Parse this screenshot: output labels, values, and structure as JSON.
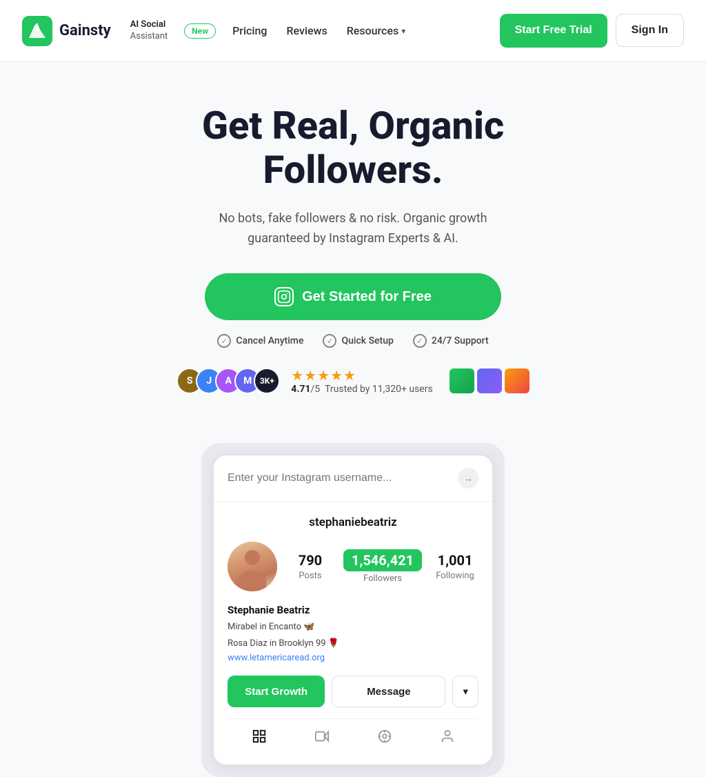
{
  "nav": {
    "logo_text": "Gainsty",
    "ai_label_line1": "AI Social",
    "ai_label_line2": "Assistant",
    "badge": "New",
    "links": [
      {
        "label": "Pricing",
        "id": "pricing"
      },
      {
        "label": "Reviews",
        "id": "reviews"
      },
      {
        "label": "Resources",
        "id": "resources"
      }
    ],
    "start_trial_btn": "Start Free Trial",
    "sign_in_btn": "Sign In"
  },
  "hero": {
    "title": "Get Real, Organic Followers.",
    "subtitle": "No bots, fake followers & no risk. Organic growth guaranteed by Instagram Experts & AI.",
    "cta_label": "Get Started for Free",
    "feature1": "Cancel Anytime",
    "feature2": "Quick Setup",
    "feature3": "24/7 Support",
    "rating_score": "4.71",
    "rating_max": "5",
    "rating_trusted": "Trusted by 11,320+ users",
    "avatar_count": "3K+"
  },
  "demo": {
    "search_placeholder": "Enter your Instagram username...",
    "username": "stephaniebeatriz",
    "posts_count": "790",
    "posts_label": "Posts",
    "followers_count": "1,546,421",
    "followers_label": "Followers",
    "following_count": "1,001",
    "following_label": "Following",
    "name": "Stephanie Beatriz",
    "bio_line1": "Mirabel in Encanto 🦋",
    "bio_line2": "Rosa Diaz in Brooklyn 99 🌹",
    "bio_link": "www.letamericaread.org",
    "btn_growth": "Start Growth",
    "btn_message": "Message"
  }
}
